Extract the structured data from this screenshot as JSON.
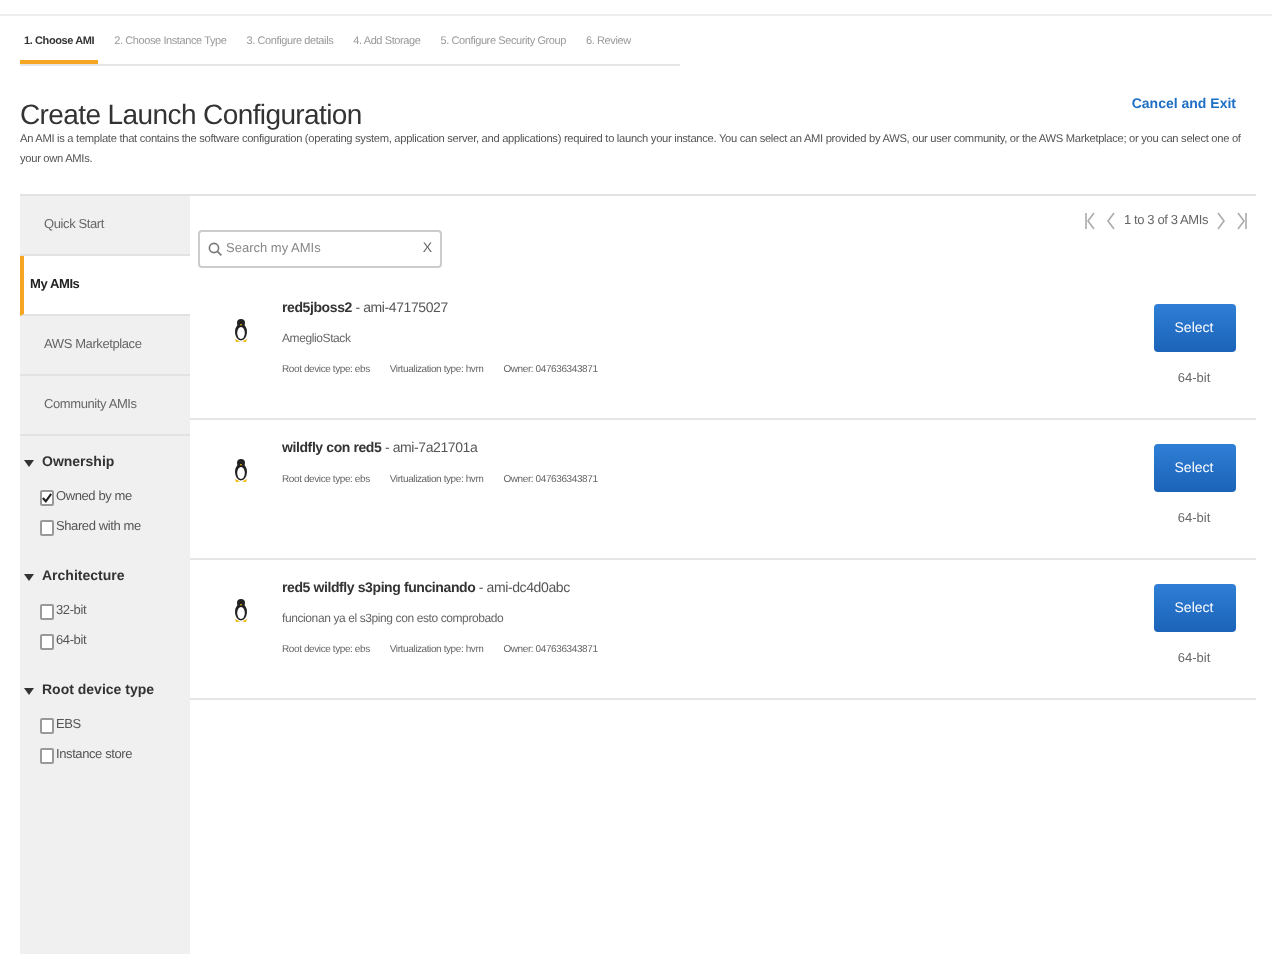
{
  "steps": [
    {
      "label": "1. Choose AMI",
      "selected": true
    },
    {
      "label": "2. Choose Instance Type",
      "selected": false
    },
    {
      "label": "3. Configure details",
      "selected": false
    },
    {
      "label": "4. Add Storage",
      "selected": false
    },
    {
      "label": "5. Configure Security Group",
      "selected": false
    },
    {
      "label": "6. Review",
      "selected": false
    }
  ],
  "title": "Create Launch Configuration",
  "cancel_link": "Cancel and Exit",
  "description": "An AMI is a template that contains the software configuration (operating system, application server, and applications) required to launch your instance. You can select an AMI provided by AWS, our user community, or the AWS Marketplace; or you can select one of your own AMIs.",
  "sidebar": {
    "items": [
      {
        "label": "Quick Start",
        "selected": false
      },
      {
        "label": "My AMIs",
        "selected": true
      },
      {
        "label": "AWS Marketplace",
        "selected": false
      },
      {
        "label": "Community AMIs",
        "selected": false
      }
    ],
    "filters": [
      {
        "title": "Ownership",
        "expanded": true,
        "options": [
          {
            "label": "Owned by me",
            "checked": true
          },
          {
            "label": "Shared with me",
            "checked": false
          }
        ]
      },
      {
        "title": "Architecture",
        "expanded": true,
        "options": [
          {
            "label": "32-bit",
            "checked": false
          },
          {
            "label": "64-bit",
            "checked": false
          }
        ]
      },
      {
        "title": "Root device type",
        "expanded": true,
        "options": [
          {
            "label": "EBS",
            "checked": false
          },
          {
            "label": "Instance store",
            "checked": false
          }
        ]
      }
    ]
  },
  "search": {
    "placeholder": "Search my AMIs",
    "clear": "X"
  },
  "pagination": {
    "text": "1 to 3 of 3 AMIs"
  },
  "amis": [
    {
      "title": "**red5jboss2** - ami-47175027",
      "description": "AmeglioStack",
      "details": [
        "Root device type: ebs",
        "Virtualization type: hvm",
        "Owner: 047636343871"
      ],
      "button": "Select",
      "architecture": "64-bit"
    },
    {
      "title": "**wildfly con red5** - ami-7a21701a",
      "details": [
        "Root device type: ebs",
        "Virtualization type: hvm",
        "Owner: 047636343871"
      ],
      "button": "Select",
      "architecture": "64-bit"
    },
    {
      "title": "**red5 wildfly s3ping funcinando** - ami-dc4d0abc",
      "description": "funcionan ya el s3ping con esto comprobado",
      "details": [
        "Root device type: ebs",
        "Virtualization type: hvm",
        "Owner: 047636343871"
      ],
      "button": "Select",
      "architecture": "64-bit"
    }
  ]
}
